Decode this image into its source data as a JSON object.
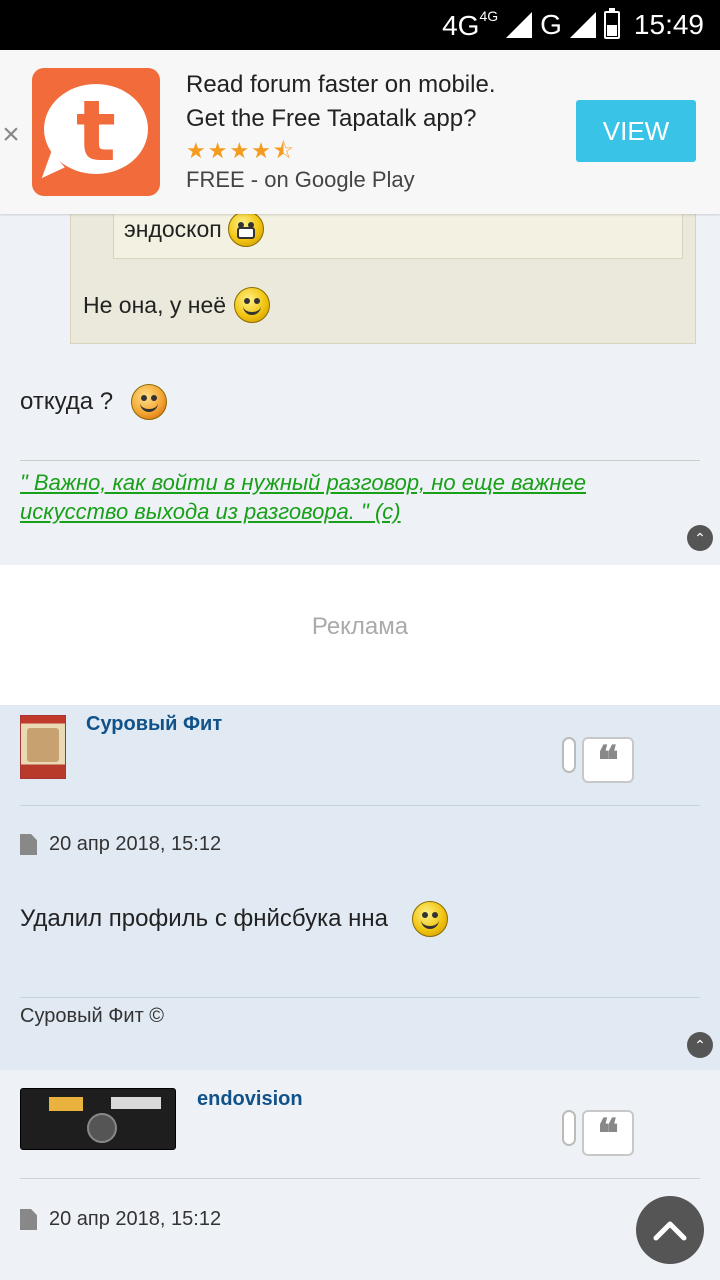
{
  "status_bar": {
    "network_1": "4G",
    "network_1_sup": "4G",
    "network_2": "G",
    "time": "15:49",
    "battery_level": 0.5
  },
  "banner": {
    "line1": "Read forum faster on mobile.",
    "line2": "Get the Free Tapatalk app?",
    "rating": 4.5,
    "stars": "★★★★⯪",
    "store_text": "FREE - on Google Play",
    "view_label": "VIEW",
    "close_glyph": "×",
    "logo_letter": "t"
  },
  "post1": {
    "inner_quote_text": "эндоскоп",
    "outer_quote_text": "Не она, у неё",
    "reply_text": "откуда ?",
    "signature": "\" Важно, как войти в нужный разговор, но еще важнее искусство выхода из разговора. \" (c)"
  },
  "ad": {
    "label": "Реклама"
  },
  "post2": {
    "author": "Суровый Фит",
    "date": "20 апр 2018, 15:12",
    "text": "Удалил профиль с фнйсбука нна",
    "signature": "Суровый Фит ©"
  },
  "post3": {
    "author": "endovision",
    "date": "20 апр 2018, 15:12"
  },
  "icons": {
    "quote_glyph": "❝",
    "scroll_up": "⌃"
  },
  "colors": {
    "tapatalk_orange": "#f26b3a",
    "view_button": "#39c3e6",
    "username_blue": "#105289",
    "signature_green": "#18a018"
  }
}
